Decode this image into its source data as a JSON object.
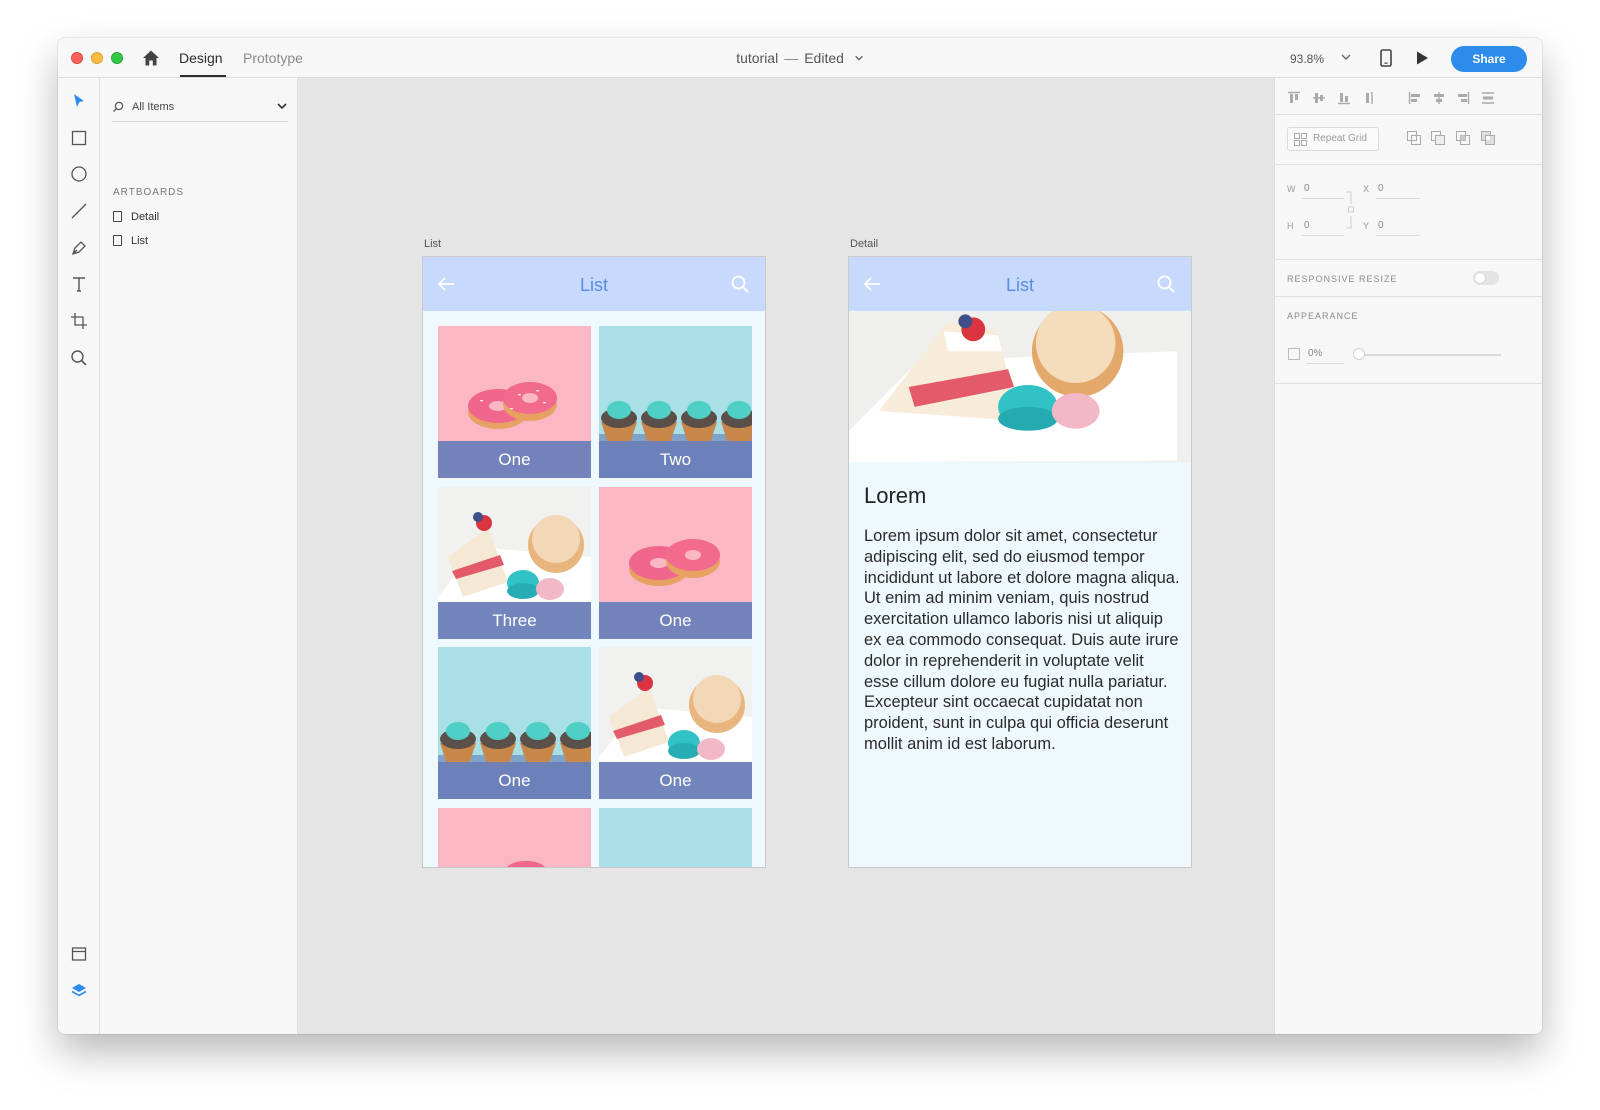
{
  "app": {
    "tabs": [
      {
        "label": "Design",
        "active": true
      },
      {
        "label": "Prototype",
        "active": false
      }
    ],
    "document": {
      "name": "tutorial",
      "separator": "—",
      "status": "Edited"
    },
    "zoom": "93.8%",
    "share_label": "Share"
  },
  "toolbar": {
    "tools": [
      "select-tool",
      "rectangle-tool",
      "ellipse-tool",
      "line-tool",
      "pen-tool",
      "text-tool",
      "artboard-tool",
      "zoom-tool"
    ],
    "bottom": [
      "assets-panel",
      "layers-panel"
    ]
  },
  "layers_panel": {
    "filter_label": "All Items",
    "section_title": "ARTBOARDS",
    "artboards": [
      "Detail",
      "List"
    ]
  },
  "canvas": {
    "list_artboard": {
      "label": "List",
      "header_title": "List",
      "tiles": [
        {
          "caption": "One",
          "image": "donuts"
        },
        {
          "caption": "Two",
          "image": "cupcakes"
        },
        {
          "caption": "Three",
          "image": "cake"
        },
        {
          "caption": "One",
          "image": "donuts"
        },
        {
          "caption": "One",
          "image": "cupcakes"
        },
        {
          "caption": "One",
          "image": "cake"
        }
      ]
    },
    "detail_artboard": {
      "label": "Detail",
      "header_title": "List",
      "heading": "Lorem",
      "body": "Lorem ipsum dolor sit amet, consectetur adipiscing elit, sed do eiusmod tempor incididunt ut labore et dolore magna aliqua. Ut enim ad minim veniam, quis nostrud exercitation ullamco laboris nisi ut aliquip ex ea commodo consequat. Duis aute irure dolor in reprehenderit in voluptate velit esse cillum dolore eu fugiat nulla pariatur. Excepteur sint occaecat cupidatat non proident, sunt in culpa qui officia deserunt mollit anim id est laborum."
    }
  },
  "properties": {
    "repeat_grid_label": "Repeat Grid",
    "w_label": "W",
    "w_value": "0",
    "h_label": "H",
    "h_value": "0",
    "x_label": "X",
    "x_value": "0",
    "y_label": "Y",
    "y_value": "0",
    "responsive_resize_label": "RESPONSIVE RESIZE",
    "responsive_resize_on": false,
    "appearance_label": "APPEARANCE",
    "opacity": "0%"
  },
  "colors": {
    "accent": "#2d8ceb",
    "app_header": "#c7d9fc",
    "app_title": "#5b8be2",
    "caption_bar": "#6c7eb9",
    "pink_bg": "#fbb8c4",
    "aqua_bg": "#a9dfe6"
  }
}
